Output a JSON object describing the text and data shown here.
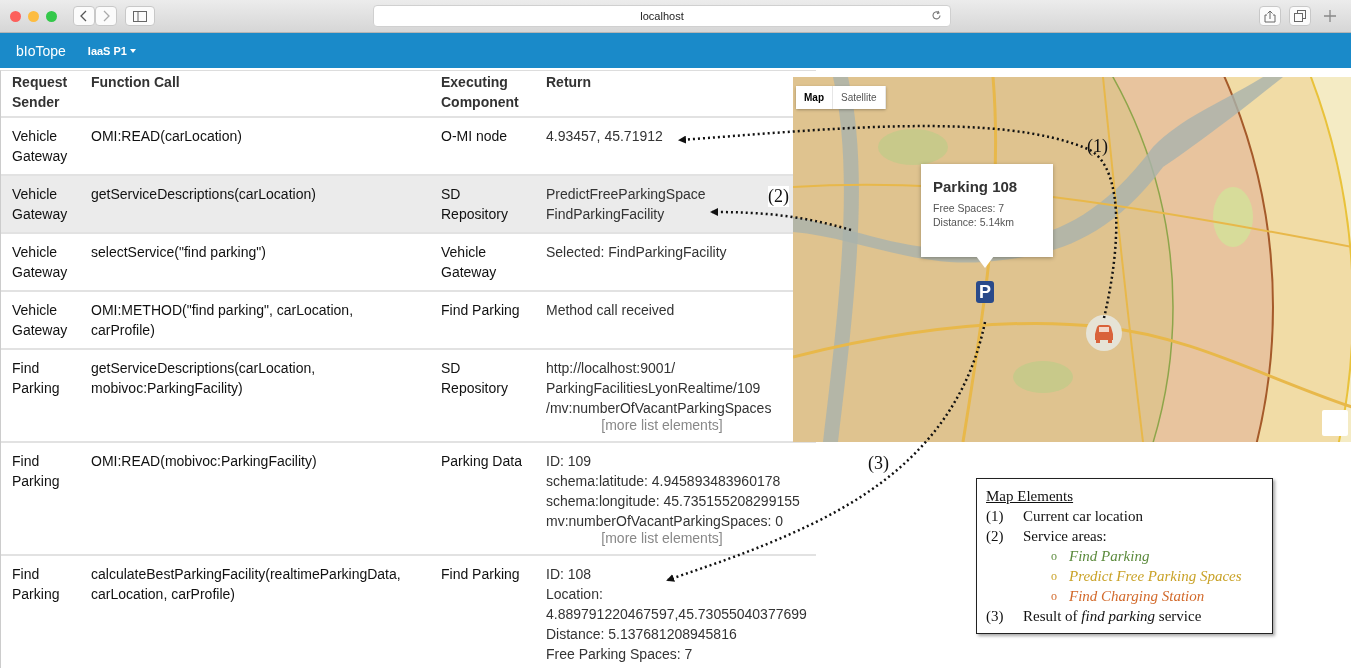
{
  "browser": {
    "address": "localhost"
  },
  "navbar": {
    "brand": "bIoTope",
    "menu": "IaaS P1"
  },
  "table": {
    "columns": [
      [
        "Request",
        "Sender"
      ],
      [
        "Function Call"
      ],
      [
        "Executing",
        "Component"
      ],
      [
        "Return"
      ]
    ],
    "rows": [
      {
        "highlighted": false,
        "sender": [
          "Vehicle",
          "Gateway"
        ],
        "call": [
          "OMI:READ(carLocation)"
        ],
        "component": [
          "O-MI node"
        ],
        "result": [
          "4.93457, 45.71912"
        ]
      },
      {
        "highlighted": true,
        "sender": [
          "Vehicle",
          "Gateway"
        ],
        "call": [
          "getServiceDescriptions(carLocation)"
        ],
        "component": [
          "SD",
          "Repository"
        ],
        "result": [
          "PredictFreeParkingSpace",
          "FindParkingFacility"
        ]
      },
      {
        "highlighted": false,
        "sender": [
          "Vehicle",
          "Gateway"
        ],
        "call": [
          "selectService(\"find parking\")"
        ],
        "component": [
          "Vehicle",
          "Gateway"
        ],
        "result": [
          "Selected: FindParkingFacility"
        ]
      },
      {
        "highlighted": false,
        "sender": [
          "Vehicle",
          "Gateway"
        ],
        "call": [
          "OMI:METHOD(\"find parking\", carLocation,",
          "carProfile)"
        ],
        "component": [
          "Find Parking"
        ],
        "result": [
          "Method call received"
        ]
      },
      {
        "highlighted": false,
        "sender": [
          "Find",
          "Parking"
        ],
        "call": [
          "getServiceDescriptions(carLocation,",
          "mobivoc:ParkingFacility)"
        ],
        "component": [
          "SD",
          "Repository"
        ],
        "result": [
          "http://localhost:9001/",
          "ParkingFacilitiesLyonRealtime/109",
          "/mv:numberOfVacantParkingSpaces"
        ],
        "more": "[more list elements]"
      },
      {
        "highlighted": false,
        "sender": [
          "Find",
          "Parking"
        ],
        "call": [
          "OMI:READ(mobivoc:ParkingFacility)"
        ],
        "component": [
          "Parking Data"
        ],
        "result": [
          "ID: 109",
          "schema:latitude: 4.945893483960178",
          "schema:longitude: 45.735155208299155",
          "mv:numberOfVacantParkingSpaces: 0"
        ],
        "more": "[more list elements]"
      },
      {
        "highlighted": false,
        "sender": [
          "Find",
          "Parking"
        ],
        "call": [
          "calculateBestParkingFacility(realtimeParkingData,",
          "carLocation, carProfile)"
        ],
        "component": [
          "Find Parking"
        ],
        "result": [
          "ID: 108",
          "Location:",
          "4.889791220467597,45.73055040377699",
          "Distance: 5.137681208945816",
          "Free Parking Spaces: 7"
        ]
      }
    ]
  },
  "map": {
    "types": [
      {
        "label": "Map",
        "selected": true
      },
      {
        "label": "Satellite",
        "selected": false
      }
    ],
    "popup": {
      "title": "Parking 108",
      "lines": [
        "Free Spaces: 7",
        "Distance: 5.14km"
      ]
    },
    "parking_marker": "P"
  },
  "annotations": [
    "(1)",
    "(2)",
    "(3)"
  ],
  "legend": {
    "title": "Map Elements",
    "items": [
      {
        "kind": "numbered",
        "number": "(1)",
        "text": "Current car location"
      },
      {
        "kind": "numbered",
        "number": "(2)",
        "text": "Service areas:"
      },
      {
        "kind": "bullet",
        "bullet": "o",
        "text": "Find Parking",
        "color": "#5b8a3c"
      },
      {
        "kind": "bullet",
        "bullet": "o",
        "text": "Predict Free Parking Spaces",
        "color": "#c9a227"
      },
      {
        "kind": "bullet",
        "bullet": "o",
        "text": "Find Charging Station",
        "color": "#d2692a"
      },
      {
        "kind": "numbered",
        "number": "(3)",
        "text": "Result of *find parking* service"
      }
    ]
  }
}
